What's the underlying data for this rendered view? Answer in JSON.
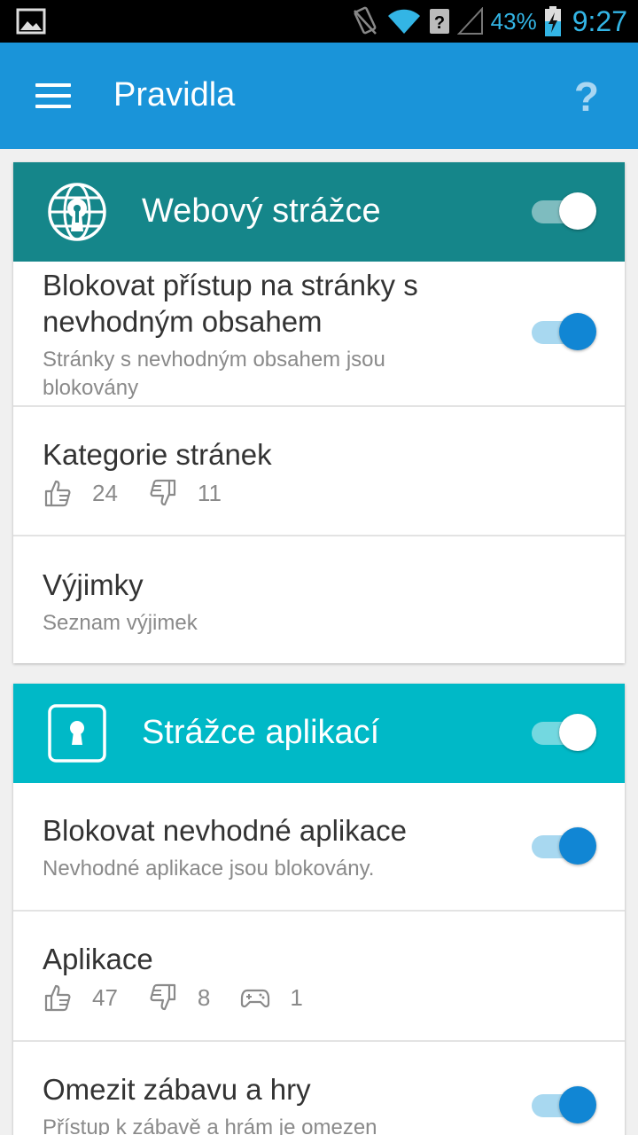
{
  "status_bar": {
    "battery_percent": "43%",
    "time": "9:27",
    "icons": [
      "image-icon",
      "vibrate-icon",
      "wifi-icon",
      "unknown-sim-icon",
      "signal-icon",
      "battery-charging-icon"
    ]
  },
  "app_bar": {
    "title": "Pravidla",
    "help_label": "?"
  },
  "web_guard": {
    "title": "Webový strážce",
    "header_color": "#15868a",
    "enabled": true,
    "block_row": {
      "title_line1": "Blokovat přístup na stránky s",
      "title_line2": "nevhodným obsahem",
      "subtitle_line1": "Stránky s nevhodným obsahem jsou",
      "subtitle_line2": "blokovány",
      "enabled": true
    },
    "categories_row": {
      "title": "Kategorie stránek",
      "allowed": "24",
      "blocked": "11"
    },
    "exceptions_row": {
      "title": "Výjimky",
      "subtitle": "Seznam výjimek"
    }
  },
  "app_guard": {
    "title": "Strážce aplikací",
    "header_color": "#00b9c7",
    "enabled": true,
    "block_row": {
      "title": "Blokovat nevhodné aplikace",
      "subtitle": "Nevhodné aplikace jsou blokovány.",
      "enabled": true
    },
    "apps_row": {
      "title": "Aplikace",
      "allowed": "47",
      "blocked": "8",
      "games": "1"
    },
    "fun_row": {
      "title": "Omezit zábavu a hry",
      "subtitle": "Přístup k zábavě a hrám je omezen",
      "enabled": true
    }
  },
  "colors": {
    "app_bar": "#1a94d9",
    "toggle_on_blue": "#1186d4"
  }
}
